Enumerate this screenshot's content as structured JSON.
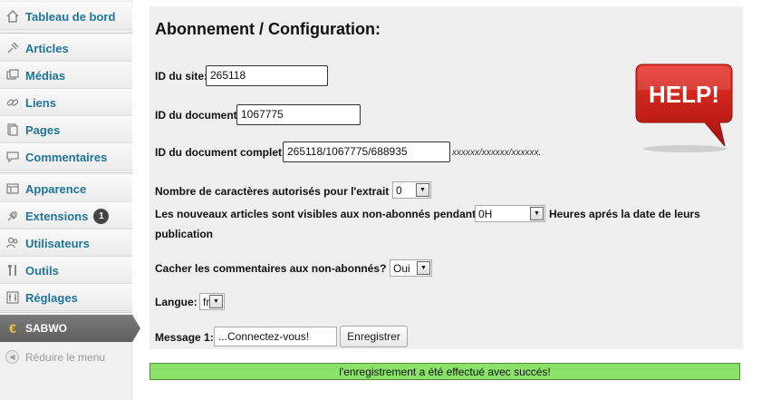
{
  "sidebar": {
    "items": [
      {
        "label": "Tableau de bord",
        "icon": "home-icon"
      },
      {
        "label": "Articles",
        "icon": "pin-icon"
      },
      {
        "label": "Médias",
        "icon": "media-icon"
      },
      {
        "label": "Liens",
        "icon": "link-icon"
      },
      {
        "label": "Pages",
        "icon": "pages-icon"
      },
      {
        "label": "Commentaires",
        "icon": "comment-icon"
      },
      {
        "label": "Apparence",
        "icon": "appearance-icon"
      },
      {
        "label": "Extensions",
        "icon": "plugin-icon",
        "badge": "1"
      },
      {
        "label": "Utilisateurs",
        "icon": "users-icon"
      },
      {
        "label": "Outils",
        "icon": "tools-icon"
      },
      {
        "label": "Réglages",
        "icon": "settings-icon"
      }
    ],
    "active": {
      "label": "SABWO",
      "icon": "euro-icon"
    },
    "collapse_label": "Réduire le menu"
  },
  "form": {
    "title": "Abonnement / Configuration:",
    "site_id_label": "ID du site:",
    "site_id_value": "265118",
    "doc_id_label": "ID du document:",
    "doc_id_value": "1067775",
    "full_doc_id_label": "ID du document complet:",
    "full_doc_id_value": "265118/1067775/688935",
    "full_doc_id_hint": "xxxxxx/xxxxxx/xxxxxx.",
    "excerpt_label": "Nombre de caractères autorisés pour l'extrait",
    "excerpt_value": "0",
    "visible_label": "Les nouveaux articles sont visibles aux non-abonnés pendant:",
    "visible_value": "0H",
    "visible_suffix_1": "Heures aprés la date de leurs",
    "visible_suffix_2": "publication",
    "hide_comments_label": "Cacher les commentaires aux non-abonnés?",
    "hide_comments_value": "Oui",
    "language_label": "Langue:",
    "language_value": "fr",
    "message_label": "Message 1:",
    "message_value": "...Connectez-vous!",
    "save_label": "Enregistrer"
  },
  "help": {
    "text": "HELP!"
  },
  "status": {
    "success": "l'enregistrement a été effectué avec succés!"
  }
}
